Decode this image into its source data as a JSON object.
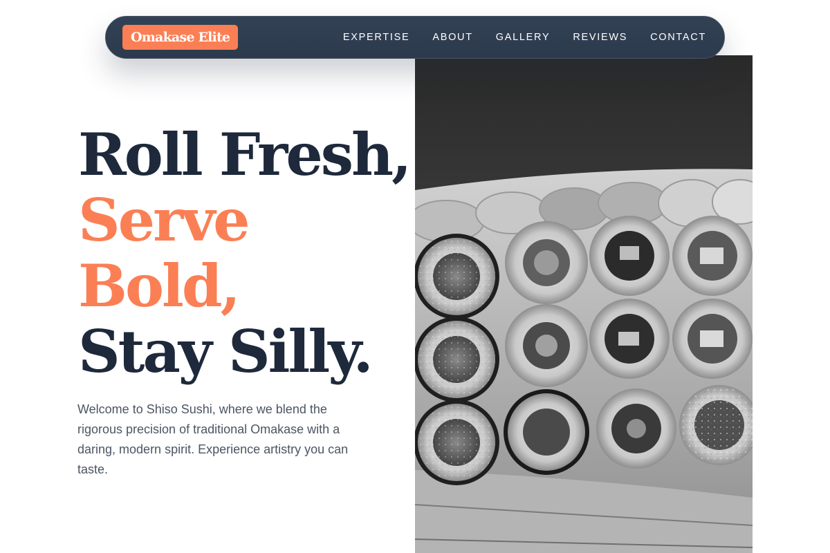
{
  "brand": {
    "logo_text": "Omakase Elite",
    "accent_color": "#fb7f55",
    "dark_color": "#1e293b"
  },
  "nav": {
    "items": [
      {
        "label": "EXPERTISE"
      },
      {
        "label": "ABOUT"
      },
      {
        "label": "GALLERY"
      },
      {
        "label": "REVIEWS"
      },
      {
        "label": "CONTACT"
      }
    ]
  },
  "hero": {
    "headline": {
      "line1": "Roll Fresh,",
      "line2": "Serve",
      "line3": "Bold,",
      "line4": "Stay Silly."
    },
    "intro": "Welcome to Shiso Sushi, where we blend the rigorous precision of traditional Omakase with a daring, modern spirit. Experience artistry you can taste.",
    "image": {
      "subject": "grayscale sushi rolls on a wooden tray",
      "icon": "photo"
    }
  }
}
